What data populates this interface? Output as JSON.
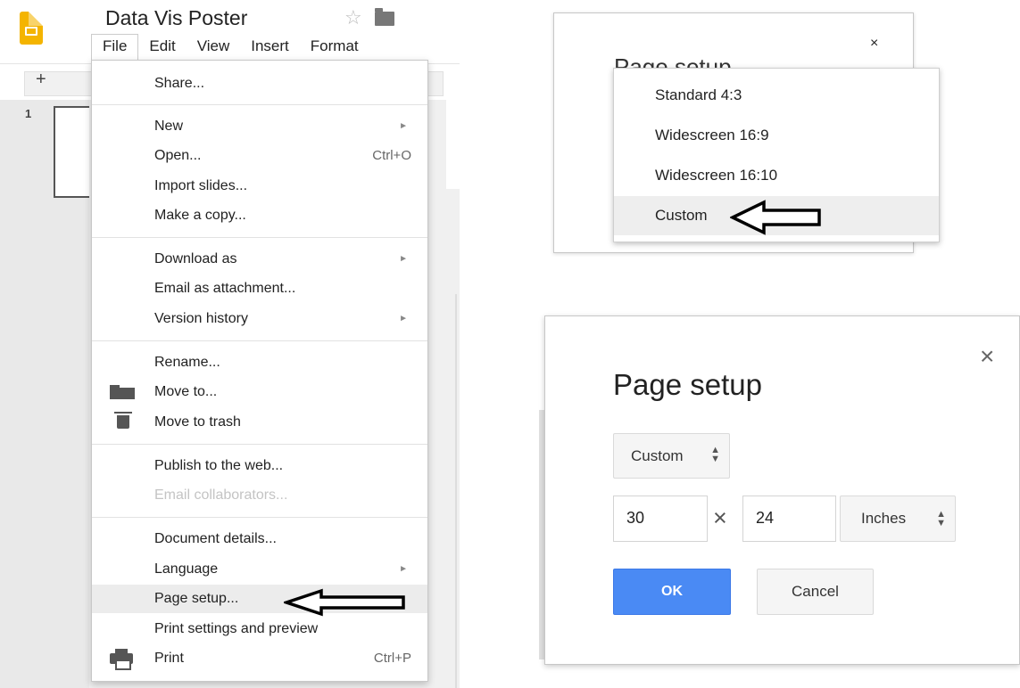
{
  "app": {
    "doc_title": "Data Vis Poster",
    "slide_number": "1",
    "toolbar_plus": "+"
  },
  "menubar": {
    "file": "File",
    "edit": "Edit",
    "view": "View",
    "insert": "Insert",
    "format": "Format"
  },
  "file_menu": {
    "share": "Share...",
    "new": "New",
    "open": "Open...",
    "open_shortcut": "Ctrl+O",
    "import_slides": "Import slides...",
    "make_copy": "Make a copy...",
    "download_as": "Download as",
    "email_attachment": "Email as attachment...",
    "version_history": "Version history",
    "rename": "Rename...",
    "move_to": "Move to...",
    "move_trash": "Move to trash",
    "publish": "Publish to the web...",
    "email_collaborators": "Email collaborators...",
    "document_details": "Document details...",
    "language": "Language",
    "page_setup": "Page setup...",
    "print_settings": "Print settings and preview",
    "print": "Print",
    "print_shortcut": "Ctrl+P",
    "submenu_arrow": "►"
  },
  "size_dropdown": {
    "partial_title": "Page setup",
    "close": "×",
    "options": [
      "Standard 4:3",
      "Widescreen 16:9",
      "Widescreen 16:10",
      "Custom"
    ],
    "highlighted": "Custom"
  },
  "page_setup": {
    "title": "Page setup",
    "close": "×",
    "size_select": "Custom",
    "width": "30",
    "times": "×",
    "height": "24",
    "unit_select": "Inches",
    "ok": "OK",
    "cancel": "Cancel"
  },
  "colors": {
    "accent_blue": "#4a8af4",
    "logo_yellow": "#f4b400",
    "highlight": "#ececec"
  },
  "icons": [
    "slides-logo-icon",
    "star-icon",
    "folder-icon",
    "move-folder-icon",
    "trash-icon",
    "print-icon",
    "close-icon",
    "updown-icon",
    "pointer-arrow-icon"
  ]
}
